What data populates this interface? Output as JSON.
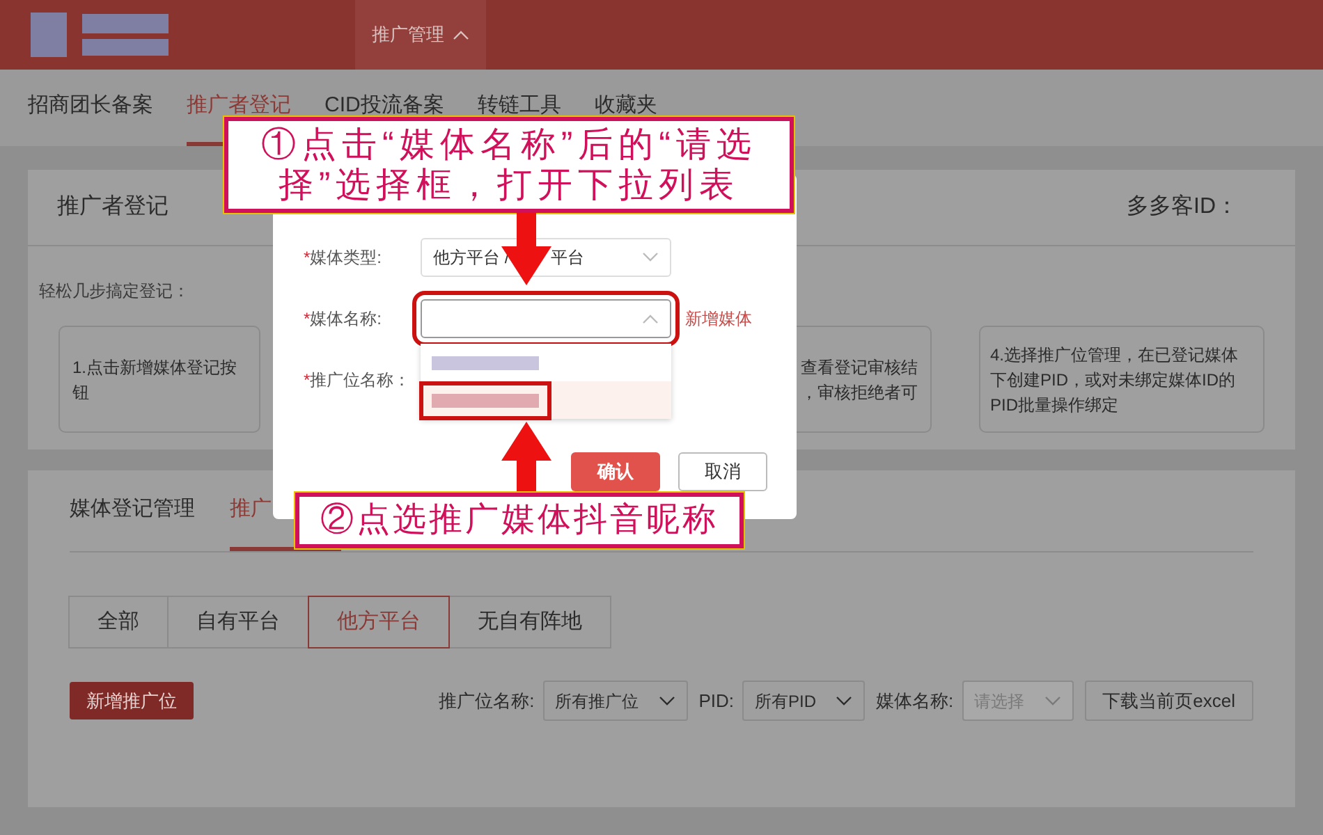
{
  "header": {
    "menu": "推广管理"
  },
  "nav_tabs": [
    {
      "label": "招商团长备案",
      "selected": false
    },
    {
      "label": "推广者登记",
      "selected": true
    },
    {
      "label": "CID投流备案",
      "selected": false
    },
    {
      "label": "转链工具",
      "selected": false
    },
    {
      "label": "收藏夹",
      "selected": false
    }
  ],
  "register_panel": {
    "title": "推广者登记",
    "id_label": "多多客ID：",
    "intro": "轻松几步搞定登记：",
    "steps": [
      {
        "kind": "full",
        "lines": [
          "1.点击新增媒体登记按",
          "钮"
        ]
      },
      {
        "kind": "partial",
        "lines": [
          "查看登记审核结",
          "，审核拒绝者可"
        ]
      },
      {
        "kind": "full",
        "lines": [
          "4.选择推广位管理，在已登记媒体",
          "下创建PID，或对未绑定媒体ID的",
          "PID批量操作绑定"
        ]
      }
    ]
  },
  "manage_panel": {
    "tabs": [
      {
        "label": "媒体登记管理",
        "selected": false
      },
      {
        "label": "推广",
        "selected": true
      }
    ],
    "segments": [
      {
        "label": "全部",
        "selected": false
      },
      {
        "label": "自有平台",
        "selected": false
      },
      {
        "label": "他方平台",
        "selected": true
      },
      {
        "label": "无自有阵地",
        "selected": false
      }
    ],
    "add_button": "新增推广位",
    "filters": [
      {
        "label": "推广位名称:",
        "value": "所有推广位",
        "disabled": false
      },
      {
        "label": "PID:",
        "value": "所有PID",
        "disabled": false
      },
      {
        "label": "媒体名称:",
        "placeholder": "请选择",
        "disabled": true
      }
    ],
    "export_button": "下载当前页excel"
  },
  "modal": {
    "fields": [
      {
        "kind": "select",
        "required_mark": "*",
        "label": "媒体类型:",
        "value_start": "他方平台 /",
        "value_end": "平台",
        "expanded": false
      },
      {
        "kind": "select",
        "required_mark": "*",
        "label": "媒体名称:",
        "expanded": true,
        "link": "新增媒体"
      },
      {
        "kind": "input",
        "required_mark": "*",
        "label": "推广位名称："
      }
    ],
    "options": [
      {
        "selected": false,
        "color": "#c9c5de"
      },
      {
        "selected": true,
        "color": "#e0aab0"
      }
    ],
    "buttons": [
      {
        "kind": "primary",
        "label": "确认"
      },
      {
        "kind": "secondary",
        "label": "取消"
      }
    ]
  },
  "callouts": [
    "①点击“媒体名称”后的“请选择”选择框，打开下拉列表",
    "②点选推广媒体抖音昵称"
  ]
}
